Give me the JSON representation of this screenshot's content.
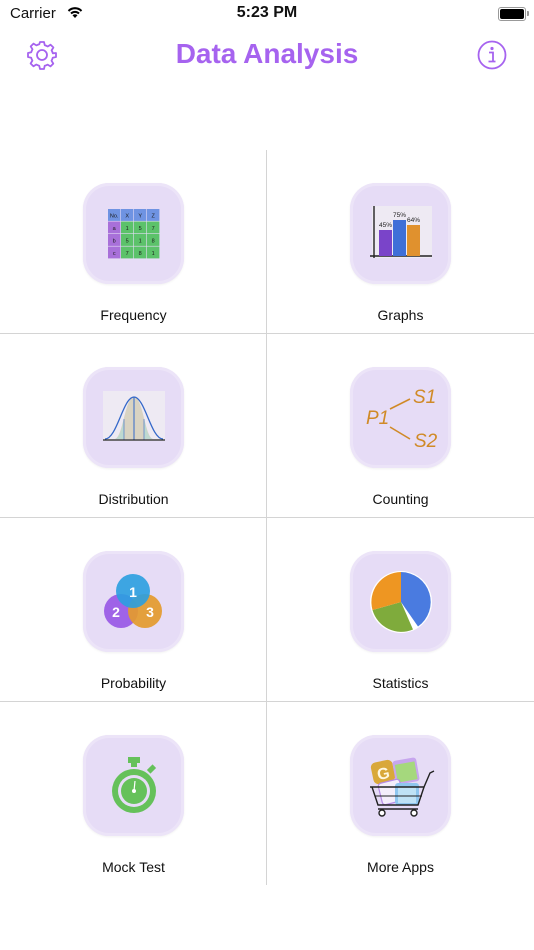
{
  "status_bar": {
    "carrier": "Carrier",
    "time": "5:23 PM"
  },
  "nav": {
    "title": "Data Analysis",
    "left_icon": "gear-icon",
    "right_icon": "info-icon"
  },
  "accent_color": "#a663ef",
  "menu": [
    {
      "label": "Frequency",
      "icon": "frequency-table-icon"
    },
    {
      "label": "Graphs",
      "icon": "bar-graph-icon",
      "bars": [
        "45%",
        "75%",
        "64%"
      ]
    },
    {
      "label": "Distribution",
      "icon": "normal-distribution-icon"
    },
    {
      "label": "Counting",
      "icon": "counting-tree-icon",
      "nodes": [
        "P1",
        "S1",
        "S2"
      ]
    },
    {
      "label": "Probability",
      "icon": "venn-diagram-icon",
      "circles": [
        "1",
        "2",
        "3"
      ]
    },
    {
      "label": "Statistics",
      "icon": "pie-chart-icon"
    },
    {
      "label": "Mock Test",
      "icon": "stopwatch-icon"
    },
    {
      "label": "More Apps",
      "icon": "shopping-cart-icon"
    }
  ],
  "frequency_table": {
    "header": [
      "No.",
      "X",
      "Y",
      "Z"
    ],
    "rows": [
      [
        "a",
        "1",
        "5",
        "7"
      ],
      [
        "b",
        "5",
        "1",
        "8"
      ],
      [
        "c",
        "7",
        "8",
        "1"
      ]
    ]
  }
}
